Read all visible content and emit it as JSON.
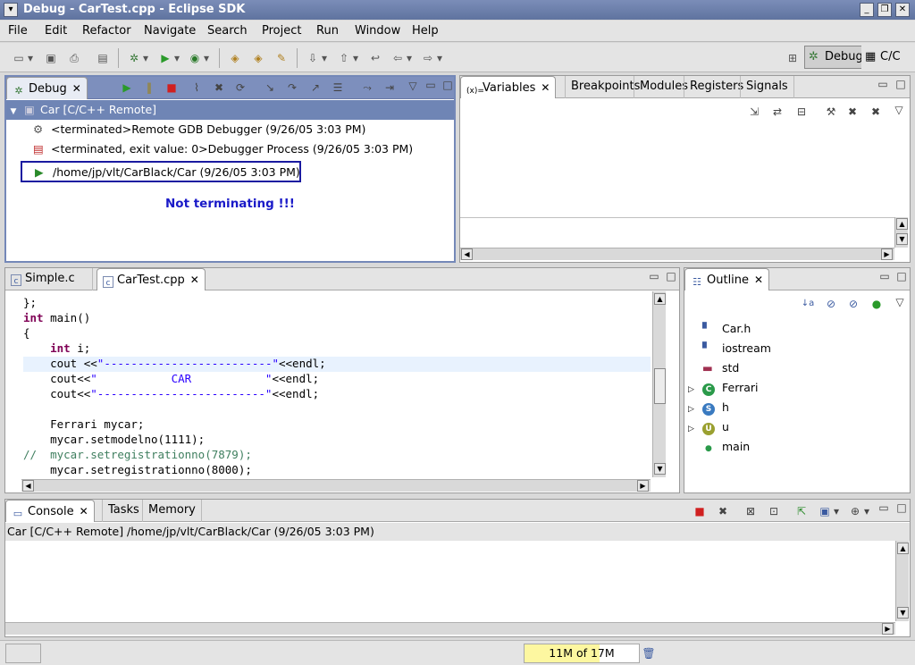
{
  "window": {
    "title": "Debug - CarTest.cpp - Eclipse SDK"
  },
  "menu": [
    "File",
    "Edit",
    "Refactor",
    "Navigate",
    "Search",
    "Project",
    "Run",
    "Window",
    "Help"
  ],
  "perspectives": {
    "debug": "Debug",
    "cc": "C/C"
  },
  "debug_view": {
    "tab": "Debug",
    "root": "Car [C/C++ Remote]",
    "items": [
      "<terminated>Remote GDB Debugger (9/26/05 3:03 PM)",
      "<terminated, exit value: 0>Debugger Process (9/26/05 3:03 PM)",
      "/home/jp/vlt/CarBlack/Car (9/26/05 3:03 PM)"
    ],
    "note": "Not terminating !!!",
    "note_color": "#1a1ac8"
  },
  "variables_view": {
    "tabs": [
      "Variables",
      "Breakpoints",
      "Modules",
      "Registers",
      "Signals"
    ]
  },
  "editor": {
    "tabs": [
      "Simple.c",
      "CarTest.cpp"
    ],
    "lines": [
      "};",
      "int main()",
      "{",
      "    int i;",
      "    cout <<\"-------------------------\"<<endl;",
      "    cout<<\"           CAR           \"<<endl;",
      "    cout<<\"-------------------------\"<<endl;",
      "",
      "    Ferrari mycar;",
      "    mycar.setmodelno(1111);",
      "//  mycar.setregistrationno(7879);",
      "    mycar.setregistrationno(8000);"
    ]
  },
  "outline": {
    "tab": "Outline",
    "items": [
      {
        "label": "Car.h",
        "icon": "include-icon"
      },
      {
        "label": "iostream",
        "icon": "include-icon"
      },
      {
        "label": "std",
        "icon": "namespace-icon"
      },
      {
        "label": "Ferrari",
        "icon": "class-icon",
        "badge": "C"
      },
      {
        "label": "h",
        "icon": "struct-icon",
        "badge": "S"
      },
      {
        "label": "u",
        "icon": "union-icon",
        "badge": "U"
      },
      {
        "label": "main",
        "icon": "function-icon"
      }
    ]
  },
  "console": {
    "tabs": [
      "Console",
      "Tasks",
      "Memory"
    ],
    "process": "Car [C/C++ Remote] /home/jp/vlt/CarBlack/Car (9/26/05 3:03 PM)"
  },
  "status": {
    "heap": "11M of 17M"
  }
}
